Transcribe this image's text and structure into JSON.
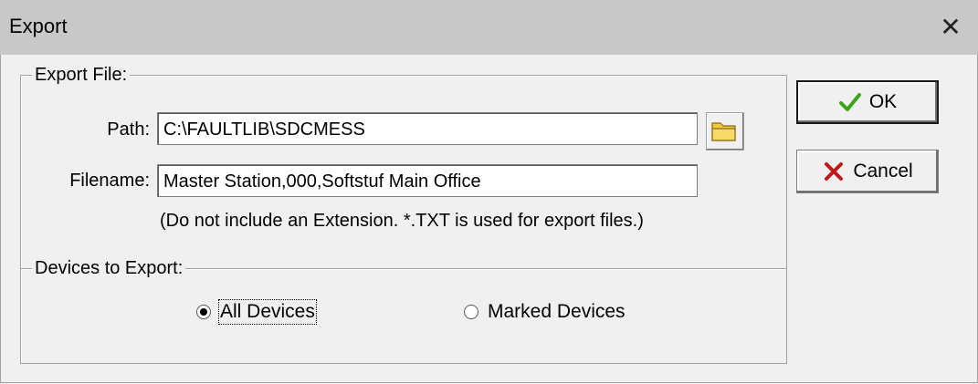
{
  "window": {
    "title": "Export",
    "close_glyph": "✕"
  },
  "export_file": {
    "legend": "Export File:",
    "path_label": "Path:",
    "path_value": "C:\\FAULTLIB\\SDCMESS",
    "filename_label": "Filename:",
    "filename_value": "Master Station,000,Softstuf Main Office",
    "hint": "(Do not include an Extension. *.TXT is used for export files.)",
    "browse_icon": "folder-icon"
  },
  "devices": {
    "legend": "Devices to Export:",
    "options": [
      {
        "label": "All Devices",
        "selected": true
      },
      {
        "label": "Marked Devices",
        "selected": false
      }
    ]
  },
  "buttons": {
    "ok_label": "OK",
    "cancel_label": "Cancel",
    "ok_icon": "checkmark-icon",
    "cancel_icon": "x-icon"
  },
  "colors": {
    "ok_green": "#3aa51a",
    "cancel_red": "#c01818",
    "folder_yellow": "#f2c744"
  }
}
